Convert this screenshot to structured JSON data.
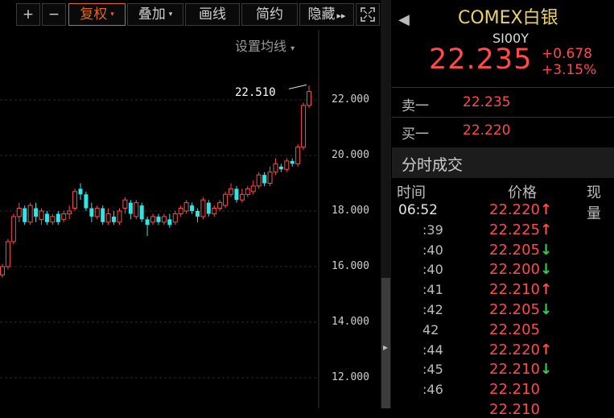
{
  "toolbar": {
    "plus_label": "+",
    "minus_label": "−",
    "fuquan_label": "复权",
    "overlay_label": "叠加",
    "draw_label": "画线",
    "simple_label": "简约",
    "hide_label": "隐藏",
    "hide_arrows": "▸▸",
    "fullscreen_icon": "fullscreen-icon",
    "dropdown_caret": "▾"
  },
  "chart": {
    "settings_label": "设置均线",
    "settings_caret": "▾",
    "last_price_label": "22.510",
    "y_ticks": [
      "22.000",
      "20.000",
      "18.000",
      "16.000",
      "14.000",
      "12.000"
    ],
    "colors": {
      "up": "#ff4a4a",
      "down": "#2ee6e6",
      "grid": "#2a2a2a"
    }
  },
  "chart_data": {
    "type": "candlestick",
    "ylim": [
      11.6,
      23.2
    ],
    "y_ticks": [
      22,
      20,
      18,
      16,
      14,
      12
    ],
    "candles": [
      {
        "o": 15.7,
        "c": 16.0,
        "h": 16.1,
        "l": 15.6,
        "up": true
      },
      {
        "o": 16.0,
        "c": 16.9,
        "h": 17.0,
        "l": 15.9,
        "up": true
      },
      {
        "o": 16.9,
        "c": 17.8,
        "h": 17.9,
        "l": 16.8,
        "up": true
      },
      {
        "o": 17.8,
        "c": 18.1,
        "h": 18.3,
        "l": 17.6,
        "up": true
      },
      {
        "o": 18.1,
        "c": 17.6,
        "h": 18.2,
        "l": 17.5,
        "up": false
      },
      {
        "o": 17.6,
        "c": 18.2,
        "h": 18.3,
        "l": 17.5,
        "up": true
      },
      {
        "o": 18.1,
        "c": 17.8,
        "h": 18.3,
        "l": 17.6,
        "up": false
      },
      {
        "o": 17.7,
        "c": 18.0,
        "h": 18.1,
        "l": 17.5,
        "up": true
      },
      {
        "o": 17.9,
        "c": 17.6,
        "h": 18.0,
        "l": 17.5,
        "up": false
      },
      {
        "o": 17.6,
        "c": 17.8,
        "h": 17.9,
        "l": 17.5,
        "up": true
      },
      {
        "o": 17.9,
        "c": 17.6,
        "h": 18.0,
        "l": 17.5,
        "up": false
      },
      {
        "o": 17.7,
        "c": 17.9,
        "h": 18.0,
        "l": 17.6,
        "up": true
      },
      {
        "o": 17.9,
        "c": 18.0,
        "h": 18.2,
        "l": 17.7,
        "up": true
      },
      {
        "o": 18.1,
        "c": 18.7,
        "h": 18.8,
        "l": 18.0,
        "up": true
      },
      {
        "o": 18.8,
        "c": 18.6,
        "h": 19.0,
        "l": 18.4,
        "up": false
      },
      {
        "o": 18.6,
        "c": 18.1,
        "h": 18.7,
        "l": 18.0,
        "up": false
      },
      {
        "o": 18.1,
        "c": 17.8,
        "h": 18.3,
        "l": 17.6,
        "up": false
      },
      {
        "o": 17.8,
        "c": 18.1,
        "h": 18.2,
        "l": 17.7,
        "up": true
      },
      {
        "o": 18.1,
        "c": 17.6,
        "h": 18.2,
        "l": 17.5,
        "up": false
      },
      {
        "o": 17.6,
        "c": 17.9,
        "h": 18.1,
        "l": 17.5,
        "up": true
      },
      {
        "o": 17.8,
        "c": 17.6,
        "h": 18.0,
        "l": 17.5,
        "up": false
      },
      {
        "o": 17.6,
        "c": 18.0,
        "h": 18.1,
        "l": 17.5,
        "up": true
      },
      {
        "o": 18.1,
        "c": 18.4,
        "h": 18.5,
        "l": 17.9,
        "up": true
      },
      {
        "o": 18.3,
        "c": 17.9,
        "h": 18.4,
        "l": 17.7,
        "up": false
      },
      {
        "o": 17.8,
        "c": 18.3,
        "h": 18.4,
        "l": 17.7,
        "up": true
      },
      {
        "o": 18.2,
        "c": 17.7,
        "h": 18.3,
        "l": 17.6,
        "up": false
      },
      {
        "o": 17.7,
        "c": 17.5,
        "h": 17.8,
        "l": 17.1,
        "up": false
      },
      {
        "o": 17.6,
        "c": 17.8,
        "h": 17.9,
        "l": 17.5,
        "up": true
      },
      {
        "o": 17.8,
        "c": 17.6,
        "h": 17.9,
        "l": 17.5,
        "up": false
      },
      {
        "o": 17.6,
        "c": 17.8,
        "h": 17.9,
        "l": 17.5,
        "up": true
      },
      {
        "o": 17.7,
        "c": 17.5,
        "h": 17.9,
        "l": 17.4,
        "up": false
      },
      {
        "o": 17.6,
        "c": 17.9,
        "h": 18.0,
        "l": 17.5,
        "up": true
      },
      {
        "o": 17.9,
        "c": 18.1,
        "h": 18.2,
        "l": 17.8,
        "up": true
      },
      {
        "o": 18.0,
        "c": 18.3,
        "h": 18.4,
        "l": 17.9,
        "up": true
      },
      {
        "o": 18.2,
        "c": 18.0,
        "h": 18.3,
        "l": 17.9,
        "up": false
      },
      {
        "o": 18.0,
        "c": 17.8,
        "h": 18.1,
        "l": 17.6,
        "up": false
      },
      {
        "o": 17.8,
        "c": 18.4,
        "h": 18.5,
        "l": 17.7,
        "up": true
      },
      {
        "o": 18.3,
        "c": 17.9,
        "h": 18.4,
        "l": 17.8,
        "up": false
      },
      {
        "o": 17.9,
        "c": 18.1,
        "h": 18.2,
        "l": 17.8,
        "up": true
      },
      {
        "o": 18.1,
        "c": 18.3,
        "h": 18.4,
        "l": 18.0,
        "up": true
      },
      {
        "o": 18.2,
        "c": 18.6,
        "h": 18.7,
        "l": 18.1,
        "up": true
      },
      {
        "o": 18.6,
        "c": 18.8,
        "h": 19.0,
        "l": 18.5,
        "up": true
      },
      {
        "o": 18.8,
        "c": 18.4,
        "h": 18.9,
        "l": 18.3,
        "up": false
      },
      {
        "o": 18.4,
        "c": 18.6,
        "h": 18.8,
        "l": 18.3,
        "up": true
      },
      {
        "o": 18.6,
        "c": 18.8,
        "h": 18.9,
        "l": 18.5,
        "up": true
      },
      {
        "o": 18.7,
        "c": 18.9,
        "h": 19.1,
        "l": 18.6,
        "up": true
      },
      {
        "o": 18.9,
        "c": 19.3,
        "h": 19.4,
        "l": 18.8,
        "up": true
      },
      {
        "o": 19.3,
        "c": 19.0,
        "h": 19.4,
        "l": 18.9,
        "up": false
      },
      {
        "o": 19.0,
        "c": 19.4,
        "h": 19.6,
        "l": 18.9,
        "up": true
      },
      {
        "o": 19.4,
        "c": 19.7,
        "h": 19.9,
        "l": 19.3,
        "up": true
      },
      {
        "o": 19.6,
        "c": 19.5,
        "h": 19.7,
        "l": 19.4,
        "up": false
      },
      {
        "o": 19.5,
        "c": 19.8,
        "h": 19.9,
        "l": 19.4,
        "up": true
      },
      {
        "o": 19.8,
        "c": 19.7,
        "h": 19.9,
        "l": 19.6,
        "up": false
      },
      {
        "o": 19.7,
        "c": 20.3,
        "h": 20.4,
        "l": 19.6,
        "up": true
      },
      {
        "o": 20.3,
        "c": 21.8,
        "h": 21.9,
        "l": 20.2,
        "up": true
      },
      {
        "o": 21.8,
        "c": 22.3,
        "h": 22.51,
        "l": 21.7,
        "up": true
      }
    ]
  },
  "quote": {
    "title": "COMEX白银",
    "code": "SI00Y",
    "price": "22.235",
    "change": "+0.678",
    "pct": "+3.15%",
    "ask_label": "卖一",
    "ask_value": "22.235",
    "bid_label": "买一",
    "bid_value": "22.220",
    "section_title": "分时成交",
    "col_time": "时间",
    "col_price": "价格",
    "col_vol": "现量"
  },
  "trades": [
    {
      "time": "06:52",
      "price": "22.220",
      "dir": "up"
    },
    {
      "time": ":39",
      "price": "22.225",
      "dir": "up"
    },
    {
      "time": ":40",
      "price": "22.205",
      "dir": "down"
    },
    {
      "time": ":40",
      "price": "22.200",
      "dir": "down"
    },
    {
      "time": ":41",
      "price": "22.210",
      "dir": "up"
    },
    {
      "time": ":42",
      "price": "22.205",
      "dir": "down"
    },
    {
      "time": "42",
      "price": "22.205",
      "dir": "none"
    },
    {
      "time": ":44",
      "price": "22.220",
      "dir": "up"
    },
    {
      "time": ":45",
      "price": "22.210",
      "dir": "down"
    },
    {
      "time": ":46",
      "price": "22.210",
      "dir": "none"
    },
    {
      "time": "",
      "price": "22.210",
      "dir": "none"
    }
  ]
}
